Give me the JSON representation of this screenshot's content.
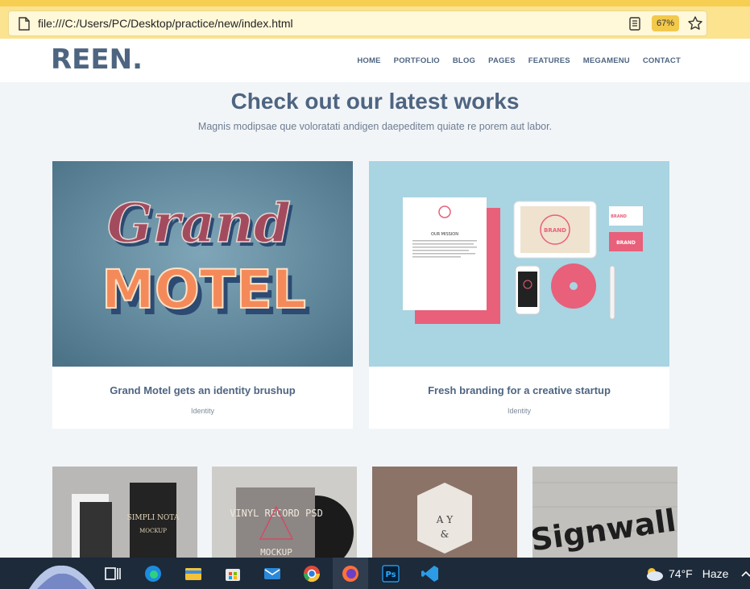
{
  "browser": {
    "url": "file:///C:/Users/PC/Desktop/practice/new/index.html",
    "zoom": "67%"
  },
  "site": {
    "logo": "REEN.",
    "nav": [
      "HOME",
      "PORTFOLIO",
      "BLOG",
      "PAGES",
      "FEATURES",
      "MEGAMENU",
      "CONTACT"
    ]
  },
  "section": {
    "title": "Check out our latest works",
    "subtitle": "Magnis modipsae que voloratati andigen daepeditem quiate re porem aut labor."
  },
  "cards": [
    {
      "title": "Grand Motel gets an identity brushup",
      "category": "Identity",
      "img_line1": "Grand",
      "img_line2": "MOTEL"
    },
    {
      "title": "Fresh branding for a creative startup",
      "category": "Identity",
      "brand": "BRAND",
      "mission": "OUR MISSION"
    }
  ],
  "thumbs": [
    {
      "text": "SIMPLI NOTA",
      "sub": "MOCKUP"
    },
    {
      "text": "VINYL RECORD PSD",
      "sub": "MOCKUP"
    },
    {
      "text": "A  Y",
      "sub": "&"
    },
    {
      "text": "Signwall"
    }
  ],
  "taskbar": {
    "temp": "74°F",
    "condition": "Haze"
  }
}
